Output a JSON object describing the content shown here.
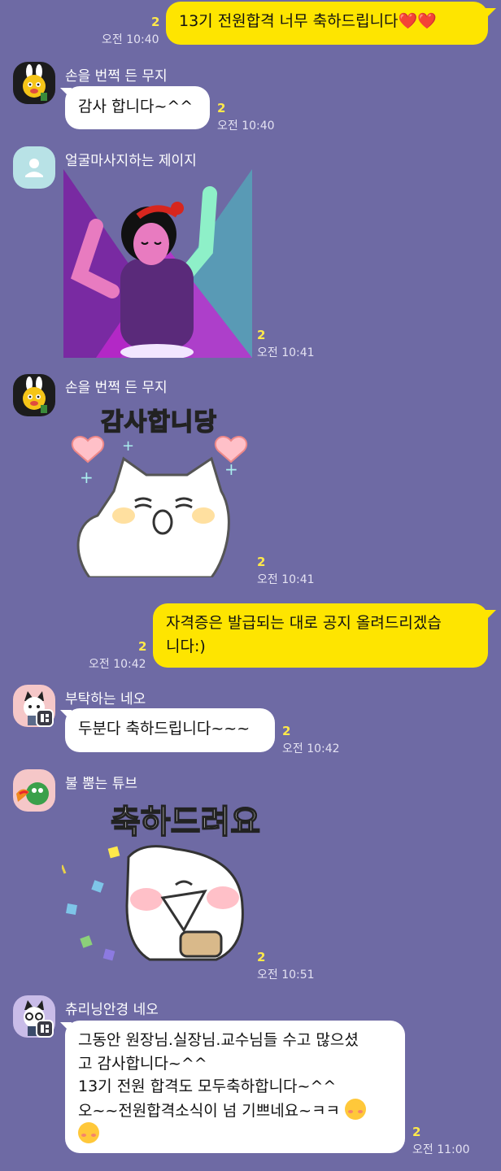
{
  "colors": {
    "background": "#6E6AA4",
    "outgoing_bubble": "#FEE500",
    "incoming_bubble": "#FFFFFF",
    "unread_count": "#FFE94A"
  },
  "messages": [
    {
      "sender": "me",
      "text": "13기 전원합격 너무 축하드립니다",
      "emoji": "❤️❤️",
      "unread": "2",
      "time": "오전 10:40"
    },
    {
      "sender": "손을 번쩍 든 무지",
      "text": "감사 합니다~^^",
      "unread": "2",
      "time": "오전 10:40"
    },
    {
      "sender": "얼굴마사지하는 제이지",
      "sticker": "dancing-figure",
      "unread": "2",
      "time": "오전 10:41"
    },
    {
      "sender": "손을 번쩍 든 무지",
      "sticker": "cat-thanks",
      "sticker_text": "감사합니당",
      "unread": "2",
      "time": "오전 10:41"
    },
    {
      "sender": "me",
      "text_line1": "자격증은 발급되는 대로 공지 올려드리겠습",
      "text_line2": "니다:)",
      "unread": "2",
      "time": "오전 10:42"
    },
    {
      "sender": "부탁하는 네오",
      "text": "두분다 축하드립니다~~~",
      "unread": "2",
      "time": "오전 10:42"
    },
    {
      "sender": "불 뿜는 튜브",
      "sticker": "congrats-blob",
      "sticker_text": "축하드려요",
      "unread": "2",
      "time": "오전 10:51"
    },
    {
      "sender": "츄리닝안경 네오",
      "lines": [
        "그동안 원장님.실장님.교수님들 수고 많으셨",
        "고  감사합니다~^^",
        "13기 전원 합격도  모두축하합니다~^^",
        "오~~전원합격소식이 넘 기쁘네요~ㅋㅋ"
      ],
      "emoji": "🥰",
      "unread": "2",
      "time": "오전 11:00"
    }
  ]
}
